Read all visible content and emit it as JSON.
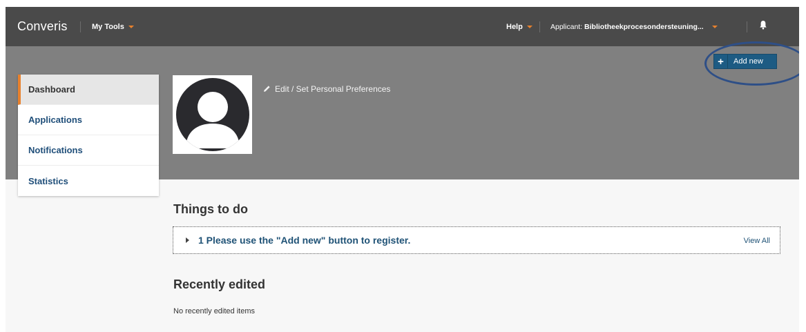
{
  "header": {
    "brand": "Converis",
    "my_tools": "My Tools",
    "help": "Help",
    "applicant_prefix": "Applicant: ",
    "applicant_name": "Bibliotheekprocesondersteuning...",
    "accent_color": "#e8812d"
  },
  "actions": {
    "add_new": "Add new",
    "add_icon": "+",
    "edit_preferences": "Edit / Set Personal Preferences"
  },
  "sidebar": {
    "items": [
      {
        "label": "Dashboard",
        "active": true
      },
      {
        "label": "Applications"
      },
      {
        "label": "Notifications"
      },
      {
        "label": "Statistics"
      }
    ]
  },
  "main": {
    "things_title": "Things to do",
    "todo_item": "1 Please use the \"Add new\" button to register.",
    "view_all": "View All",
    "recent_title": "Recently edited",
    "recent_empty": "No recently edited items"
  },
  "icons": {
    "avatar": "user-avatar-icon",
    "edit": "pencil-icon",
    "bell": "bell-icon",
    "expand": "triangle-right-icon"
  }
}
